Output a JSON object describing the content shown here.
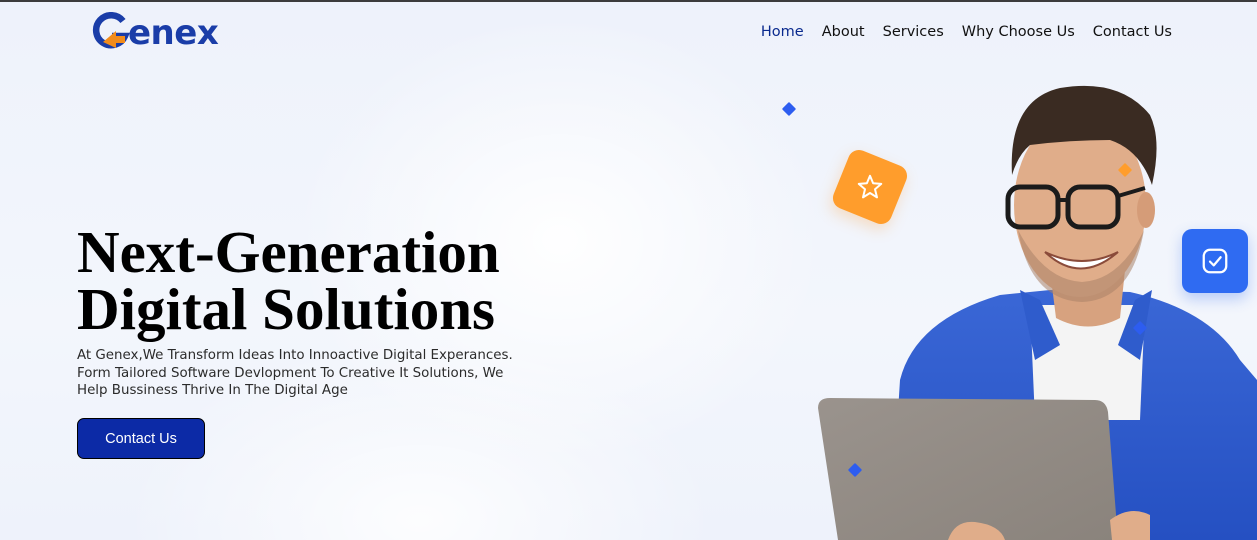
{
  "brand": {
    "name": "Genex",
    "logo_initial": "G",
    "logo_rest": "enex",
    "primary_color": "#1a3da8",
    "accent_color": "#f28c1c"
  },
  "nav": {
    "items": [
      {
        "label": "Home",
        "active": true
      },
      {
        "label": "About",
        "active": false
      },
      {
        "label": "Services",
        "active": false
      },
      {
        "label": "Why Choose Us",
        "active": false
      },
      {
        "label": "Contact Us",
        "active": false
      }
    ]
  },
  "hero": {
    "title_line1": "Next-Generation",
    "title_line2": "Digital Solutions",
    "description": "At Genex,We Transform Ideas Into Innoactive Digital Experances. Form Tailored Software Devlopment To Creative It Solutions, We Help Bussiness Thrive In The Digital Age",
    "cta_label": "Contact Us",
    "cta_color": "#0c2aa6"
  },
  "illustration": {
    "subject": "smiling man with glasses holding laptop",
    "badges": [
      {
        "icon": "star-icon",
        "color": "#ff9d2c"
      },
      {
        "icon": "check-square-icon",
        "color": "#2f6bf2"
      }
    ]
  }
}
